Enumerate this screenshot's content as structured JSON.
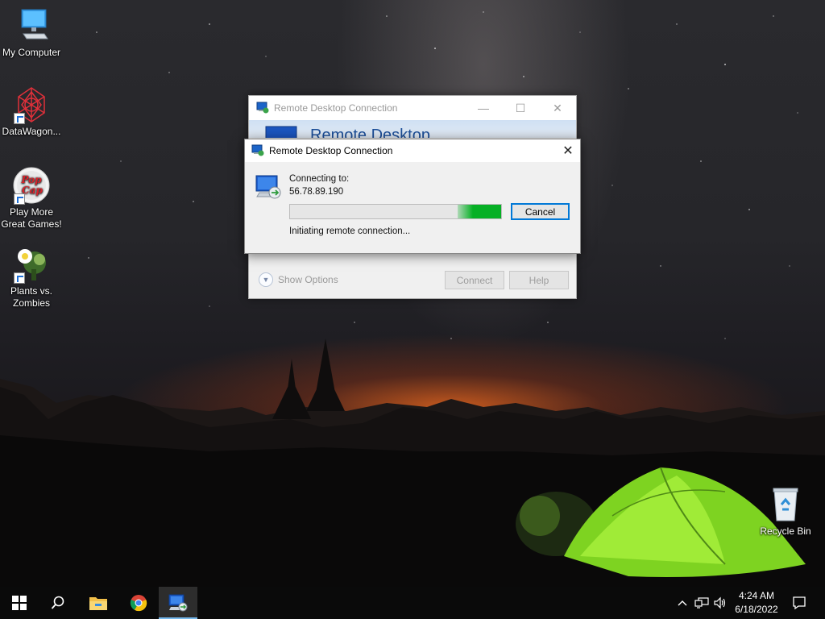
{
  "desktop": {
    "icons": [
      {
        "label": "My Computer"
      },
      {
        "label": "DataWagon..."
      },
      {
        "label": "Play More Great Games!"
      },
      {
        "label": "Plants vs. Zombies"
      },
      {
        "label": "Recycle Bin"
      }
    ]
  },
  "main_window": {
    "title": "Remote Desktop Connection",
    "banner_text": "Remote Desktop",
    "show_options": "Show Options",
    "connect_label": "Connect",
    "help_label": "Help"
  },
  "connecting_dialog": {
    "title": "Remote Desktop Connection",
    "connecting_label": "Connecting to:",
    "host": "56.78.89.190",
    "status": "Initiating remote connection...",
    "cancel_label": "Cancel",
    "progress_indicator": "marquee"
  },
  "taskbar": {
    "pinned": [
      "start-icon",
      "search-icon",
      "file-explorer-icon",
      "chrome-icon",
      "remote-desktop-icon"
    ],
    "active": "remote-desktop-icon",
    "tray_icons": [
      "chevron-up-icon",
      "network-icon",
      "volume-icon",
      "notification-icon"
    ],
    "time": "4:24 AM",
    "date": "6/18/2022"
  },
  "colors": {
    "progress_green": "#06b025",
    "focus_blue": "#0078d7",
    "taskbar": "#0a0a0a"
  }
}
